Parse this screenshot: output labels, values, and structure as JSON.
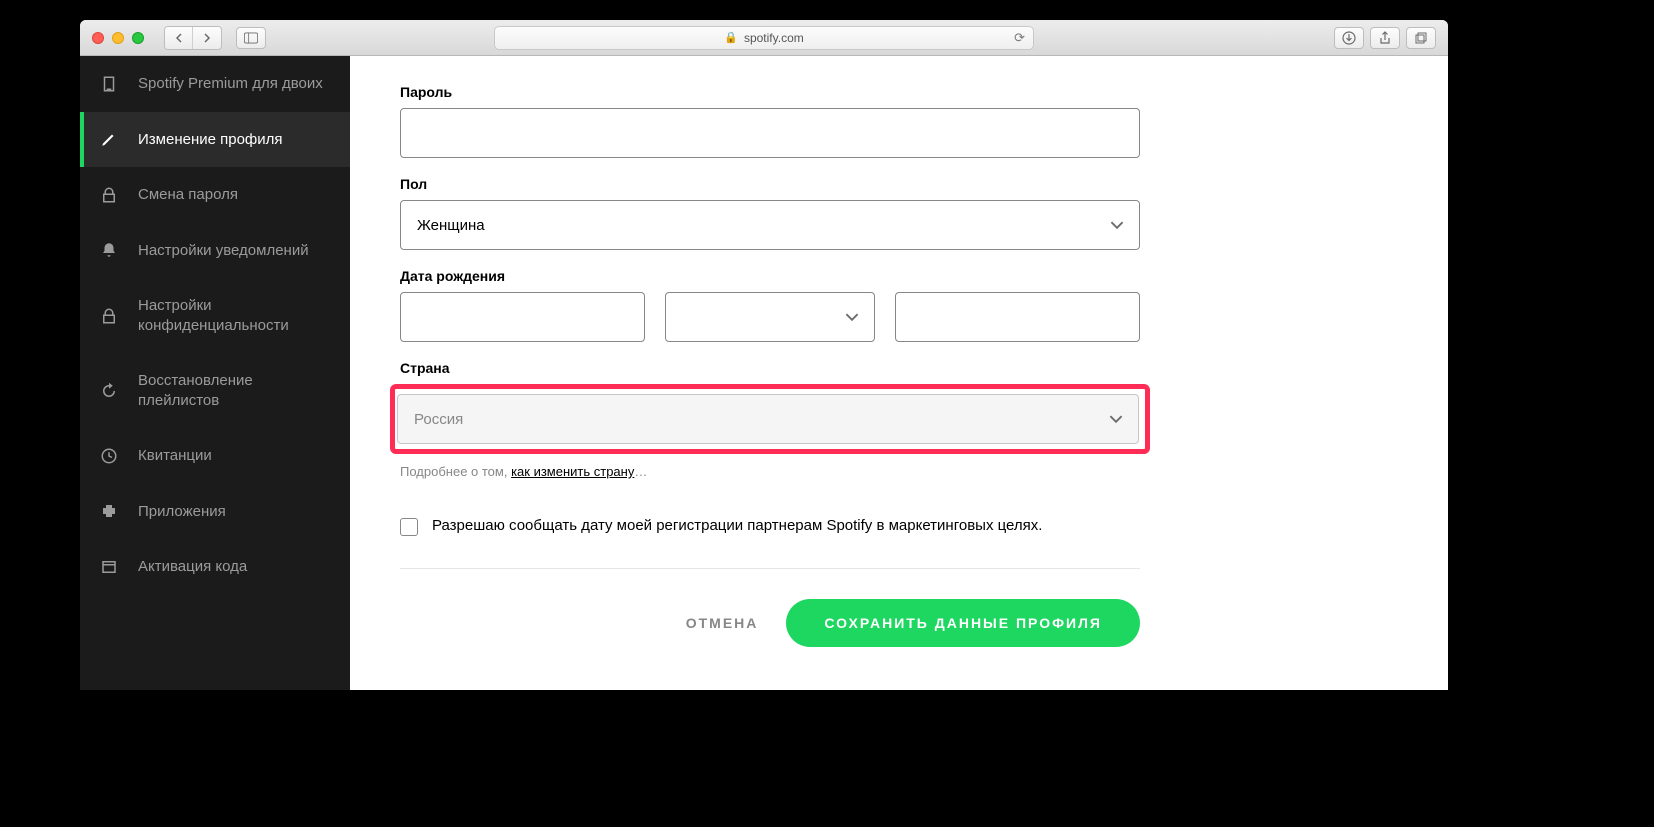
{
  "browser": {
    "url_host": "spotify.com"
  },
  "sidebar": {
    "items": [
      {
        "label": "Spotify Premium для двоих"
      },
      {
        "label": "Изменение профиля"
      },
      {
        "label": "Смена пароля"
      },
      {
        "label": "Настройки уведомлений"
      },
      {
        "label": "Настройки конфиденциальности"
      },
      {
        "label": "Восстановление плейлистов"
      },
      {
        "label": "Квитанции"
      },
      {
        "label": "Приложения"
      },
      {
        "label": "Активация кода"
      }
    ]
  },
  "form": {
    "password_label": "Пароль",
    "password_value": "",
    "gender_label": "Пол",
    "gender_value": "Женщина",
    "dob_label": "Дата рождения",
    "dob_day": "",
    "dob_month": "",
    "dob_year": "",
    "country_label": "Страна",
    "country_value": "Россия",
    "country_hint_prefix": "Подробнее о том, ",
    "country_hint_link": "как изменить страну",
    "country_hint_suffix": "…",
    "marketing_consent_label": "Разрешаю сообщать дату моей регистрации партнерам Spotify в маркетинговых целях.",
    "cancel_label": "ОТМЕНА",
    "save_label": "СОХРАНИТЬ ДАННЫЕ ПРОФИЛЯ"
  }
}
